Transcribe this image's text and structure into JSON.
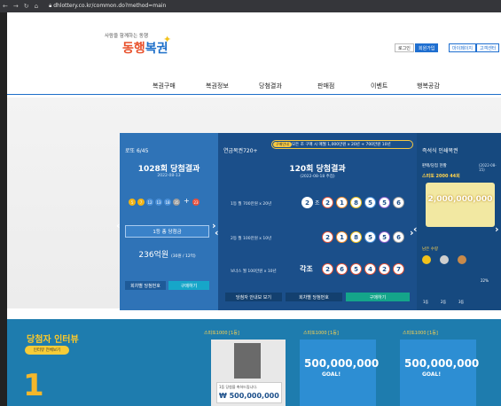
{
  "browser": {
    "url": "dhlottery.co.kr/common.do?method=main",
    "nav_icons": [
      "back-icon",
      "forward-icon",
      "reload-icon",
      "home-icon",
      "lock-icon"
    ]
  },
  "header": {
    "slogan": "사람을 함께하는 동행",
    "logo_text_1": "동행",
    "logo_text_2": "복권",
    "buttons": [
      "로그인",
      "회원가입",
      "마이페이지",
      "고객센터"
    ]
  },
  "gnb": {
    "items": [
      "복권구매",
      "복권정보",
      "당첨결과",
      "판매점",
      "이벤트",
      "행복공감"
    ]
  },
  "lotto": {
    "title": "로또 6/45",
    "round": "1028회 당첨결과",
    "date": "2022-08-13",
    "balls": [
      "5",
      "7",
      "12",
      "13",
      "18",
      "35"
    ],
    "bonus": "23",
    "prize_label": "1등 총 당첨금",
    "amount": "236억원",
    "amount_sub": "(30원 / 12억)",
    "btn_check": "회차별 당첨번호",
    "btn_buy": "구매하기"
  },
  "pension": {
    "title": "연금복권720+",
    "tag": "구매안내",
    "notice": "모든 조 구매 시 매월 1,000만원 x 20년 + 700만원 10년",
    "round": "120회 당첨결과",
    "date": "(2022-08-18 추첨)",
    "row1_label": "1등 월 700만원 x 20년",
    "row2_label": "2등 월 100만원 x 10년",
    "row3_label": "보너스 월 100만원 x 10년",
    "group": "2",
    "group_suffix": "조",
    "row1_nums": [
      "2",
      "1",
      "8",
      "5",
      "5",
      "6"
    ],
    "row2_nums": [
      "2",
      "1",
      "8",
      "5",
      "5",
      "6"
    ],
    "bonus_prefix": "각조",
    "bonus_nums": [
      "2",
      "6",
      "5",
      "4",
      "2",
      "7"
    ],
    "btn_view": "당첨자 안내보 보기",
    "btn_check": "회차별 당첨번호",
    "btn_buy": "구매하기"
  },
  "instant": {
    "title": "즉석식 인쇄복권",
    "label": "판매/당첨 현황",
    "label_date": "(2022-08-15)",
    "product": "스피또 2000 44회",
    "card_amount": "2,000,000,000",
    "remain": "남은 수량",
    "prize_cols": [
      "1등",
      "2등",
      "3등"
    ],
    "rate": "22%"
  },
  "bottom": {
    "title": "당첨자 인터뷰",
    "btn": "인터뷰 전체보기",
    "tab1": "스피또1000 [1등]",
    "tab2": "스피또1000 [1등]",
    "tab3": "스피또1000 [1등]",
    "cheque_text": "1등 당첨을 축하드립니다.",
    "cheque_amount": "₩ 500,000,000",
    "scratch_amount": "500,000,000",
    "goal": "GOAL!",
    "big_num": "1"
  },
  "colors": {
    "lotto_panel": "#2f73b7",
    "pension_panel": "#1b4f8a",
    "instant_panel": "#16497f",
    "bottom_band": "#1e7cae"
  }
}
